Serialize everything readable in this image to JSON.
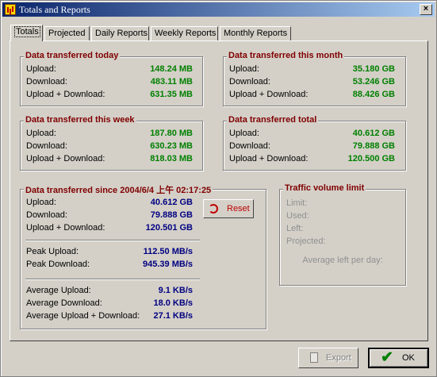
{
  "window": {
    "title": "Totals and Reports",
    "close_glyph": "×"
  },
  "tabs": [
    "Totals",
    "Projected",
    "Daily Reports",
    "Weekly Reports",
    "Monthly Reports"
  ],
  "today": {
    "title": "Data transferred today",
    "rows": [
      {
        "label": "Upload:",
        "value": "148.24 MB"
      },
      {
        "label": "Download:",
        "value": "483.11 MB"
      },
      {
        "label": "Upload + Download:",
        "value": "631.35 MB"
      }
    ]
  },
  "month": {
    "title": "Data transferred this month",
    "rows": [
      {
        "label": "Upload:",
        "value": "35.180 GB"
      },
      {
        "label": "Download:",
        "value": "53.246 GB"
      },
      {
        "label": "Upload + Download:",
        "value": "88.426 GB"
      }
    ]
  },
  "week": {
    "title": "Data transferred this week",
    "rows": [
      {
        "label": "Upload:",
        "value": "187.80 MB"
      },
      {
        "label": "Download:",
        "value": "630.23 MB"
      },
      {
        "label": "Upload + Download:",
        "value": "818.03 MB"
      }
    ]
  },
  "total": {
    "title": "Data transferred total",
    "rows": [
      {
        "label": "Upload:",
        "value": "40.612 GB"
      },
      {
        "label": "Download:",
        "value": "79.888 GB"
      },
      {
        "label": "Upload + Download:",
        "value": "120.500 GB"
      }
    ]
  },
  "since": {
    "title": "Data transferred since 2004/6/4 上午 02:17:25",
    "rows": [
      {
        "label": "Upload:",
        "value": "40.612 GB"
      },
      {
        "label": "Download:",
        "value": "79.888 GB"
      },
      {
        "label": "Upload + Download:",
        "value": "120.501 GB"
      }
    ],
    "peak": [
      {
        "label": "Peak Upload:",
        "value": "112.50 MB/s"
      },
      {
        "label": "Peak Download:",
        "value": "945.39 MB/s"
      }
    ],
    "average": [
      {
        "label": "Average Upload:",
        "value": "9.1 KB/s"
      },
      {
        "label": "Average Download:",
        "value": "18.0 KB/s"
      },
      {
        "label": "Average Upload + Download:",
        "value": "27.1 KB/s"
      }
    ],
    "reset_label": "Reset"
  },
  "limit": {
    "title": "Traffic volume limit",
    "labels": [
      "Limit:",
      "Used:",
      "Left:",
      "Projected:"
    ],
    "average_left": "Average left per day:"
  },
  "buttons": {
    "export_label": "Export",
    "ok_label": "OK"
  },
  "colors": {
    "title_bar": "#0a246a",
    "group_title": "#800000",
    "value_green": "#008000",
    "value_blue": "#000080",
    "reset_red": "#c00000"
  }
}
